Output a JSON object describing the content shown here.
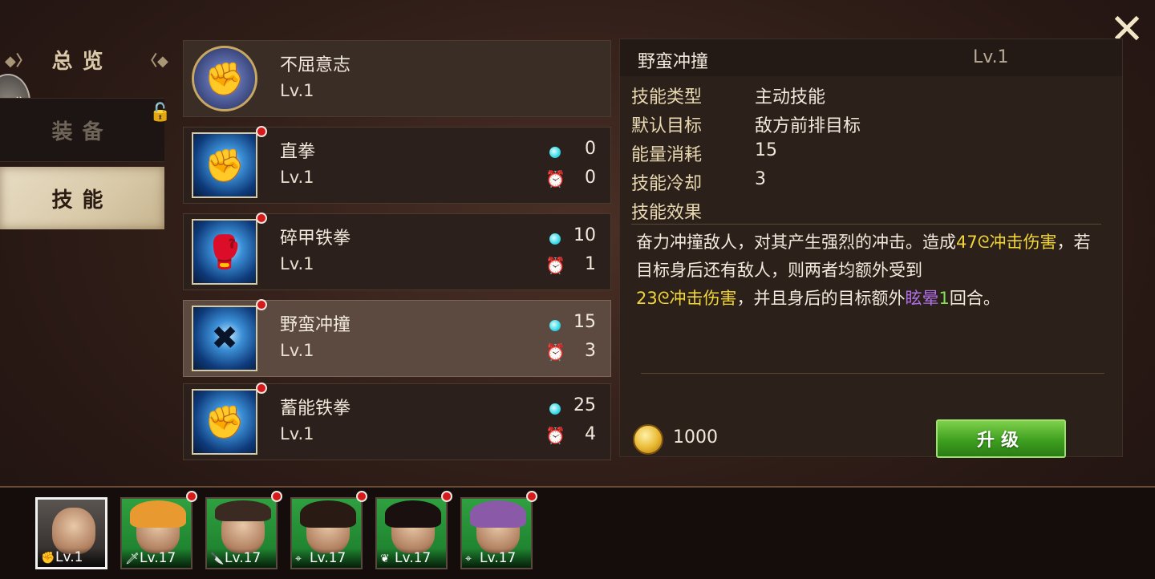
{
  "window": {
    "close_icon": "close-icon"
  },
  "nav": {
    "overview": "总览",
    "equipment": "装备",
    "skills": "技能",
    "expand_icon": "double-chevron-right-icon",
    "lock_icon": "lock-icon"
  },
  "skills": [
    {
      "name": "不屈意志",
      "level": "Lv.1",
      "energy": "",
      "cooldown": "",
      "passive": true
    },
    {
      "name": "直拳",
      "level": "Lv.1",
      "energy": "0",
      "cooldown": "0"
    },
    {
      "name": "碎甲铁拳",
      "level": "Lv.1",
      "energy": "10",
      "cooldown": "1"
    },
    {
      "name": "野蛮冲撞",
      "level": "Lv.1",
      "energy": "15",
      "cooldown": "3",
      "selected": true
    },
    {
      "name": "蓄能铁拳",
      "level": "Lv.1",
      "energy": "25",
      "cooldown": "4"
    }
  ],
  "detail": {
    "title": "野蛮冲撞",
    "level": "Lv.1",
    "attributes": [
      {
        "label": "技能类型",
        "value": "主动技能"
      },
      {
        "label": "默认目标",
        "value": "敌方前排目标"
      },
      {
        "label": "能量消耗",
        "value": "15"
      },
      {
        "label": "技能冷却",
        "value": "3"
      },
      {
        "label": "技能效果",
        "value": ""
      }
    ],
    "effect": {
      "p1": "奋力冲撞敌人，对其产生强烈的冲击。造成",
      "v1": "47",
      "t1": "冲击伤害",
      "p2": "，若目标身后还有敌人，则两者均额外受到",
      "v2": "23",
      "t2": "冲击伤害",
      "p3": "，并且身后的目标额外",
      "status": "眩晕",
      "rounds": "1",
      "p4": "回合。"
    },
    "cost": "1000",
    "upgrade_label": "升级"
  },
  "heroes": [
    {
      "level": "Lv.1",
      "class_icon": "fist-icon",
      "active": true,
      "alert": false
    },
    {
      "level": "Lv.17",
      "class_icon": "sword-icon",
      "active": false,
      "alert": true
    },
    {
      "level": "Lv.17",
      "class_icon": "dagger-icon",
      "active": false,
      "alert": true
    },
    {
      "level": "Lv.17",
      "class_icon": "crosshair-icon",
      "active": false,
      "alert": true
    },
    {
      "level": "Lv.17",
      "class_icon": "heal-icon",
      "active": false,
      "alert": true
    },
    {
      "level": "Lv.17",
      "class_icon": "crosshair-icon",
      "active": false,
      "alert": true
    }
  ],
  "colors": {
    "accent_gold": "#f1d63a",
    "stun_purple": "#b070e8",
    "round_green": "#7fe05a",
    "upgrade_green": "#3ea020",
    "alert_red": "#d51a1a",
    "energy_cyan": "#36d8e8"
  }
}
